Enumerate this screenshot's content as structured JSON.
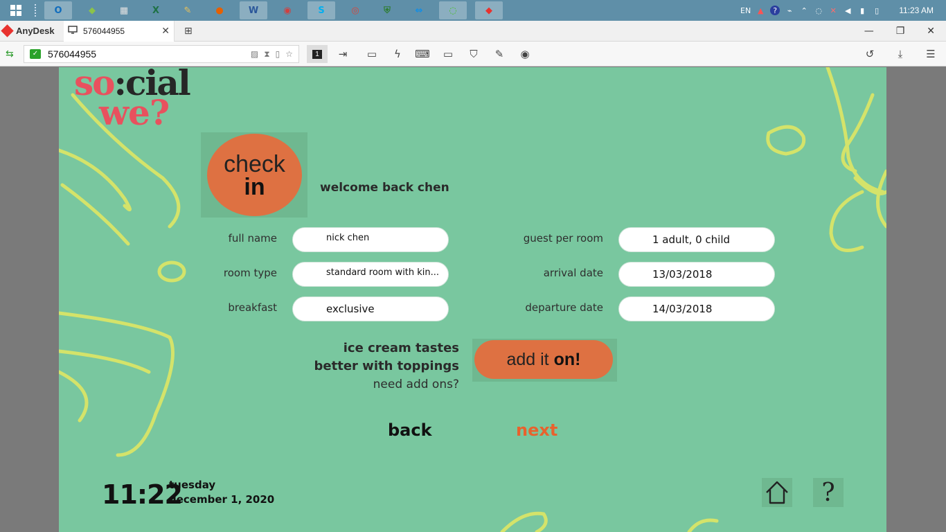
{
  "taskbar": {
    "apps": [
      {
        "name": "outlook-icon",
        "glyph": "O",
        "color": "#0f6cbd"
      },
      {
        "name": "app-green-icon",
        "glyph": "◆",
        "color": "#8bc34a"
      },
      {
        "name": "calculator-icon",
        "glyph": "▦",
        "color": "#e0e0e0"
      },
      {
        "name": "excel-icon",
        "glyph": "X",
        "color": "#1e7145"
      },
      {
        "name": "brush-icon",
        "glyph": "✎",
        "color": "#e8c15a"
      },
      {
        "name": "firefox-icon",
        "glyph": "●",
        "color": "#e66000"
      },
      {
        "name": "word-icon",
        "glyph": "W",
        "color": "#2b579a"
      },
      {
        "name": "paint-icon",
        "glyph": "◉",
        "color": "#d04040"
      },
      {
        "name": "skype-icon",
        "glyph": "S",
        "color": "#00aff0"
      },
      {
        "name": "chrome-icon",
        "glyph": "◎",
        "color": "#db4437"
      },
      {
        "name": "security-shield-icon",
        "glyph": "⛨",
        "color": "#2e7d32"
      },
      {
        "name": "teamviewer-icon",
        "glyph": "⇔",
        "color": "#0e8ee9"
      },
      {
        "name": "wechat-icon",
        "glyph": "◌",
        "color": "#46c21f"
      },
      {
        "name": "anydesk-icon",
        "glyph": "◆",
        "color": "#e8322e"
      }
    ],
    "tray": {
      "language": "EN",
      "time": "11:23 AM"
    }
  },
  "anydesk": {
    "brand": "AnyDesk",
    "tab_label": "576044955",
    "address": "576044955",
    "monitor_number": "1"
  },
  "app": {
    "logo_line1_part1": "so",
    "logo_line1_part2": ":cial",
    "logo_line2": "we?",
    "checkin_line1": "check",
    "checkin_line2": "in",
    "welcome": "welcome back chen",
    "form": {
      "full_name_label": "full name",
      "full_name_value": "nick chen",
      "room_type_label": "room type",
      "room_type_value": "standard room with kin...",
      "breakfast_label": "breakfast",
      "breakfast_value": "exclusive",
      "guest_label": "guest per room",
      "guest_value": "1 adult,  0 child",
      "arrival_label": "arrival date",
      "arrival_value": "13/03/2018",
      "departure_label": "departure date",
      "departure_value": "14/03/2018"
    },
    "addon": {
      "line1": "ice cream tastes",
      "line2": "better with toppings",
      "line3": "need add ons?",
      "button_part1": "add it",
      "button_part2": "on!"
    },
    "nav": {
      "back": "back",
      "next": "next"
    },
    "clock": {
      "time": "11:22",
      "day": "tuesday",
      "date": "december 1, 2020"
    }
  },
  "colors": {
    "background": "#79c79f",
    "accent_orange": "#de7142",
    "next_orange": "#e8622d",
    "logo_red": "#e8515e",
    "doodle_yellow": "#d4e36a"
  }
}
